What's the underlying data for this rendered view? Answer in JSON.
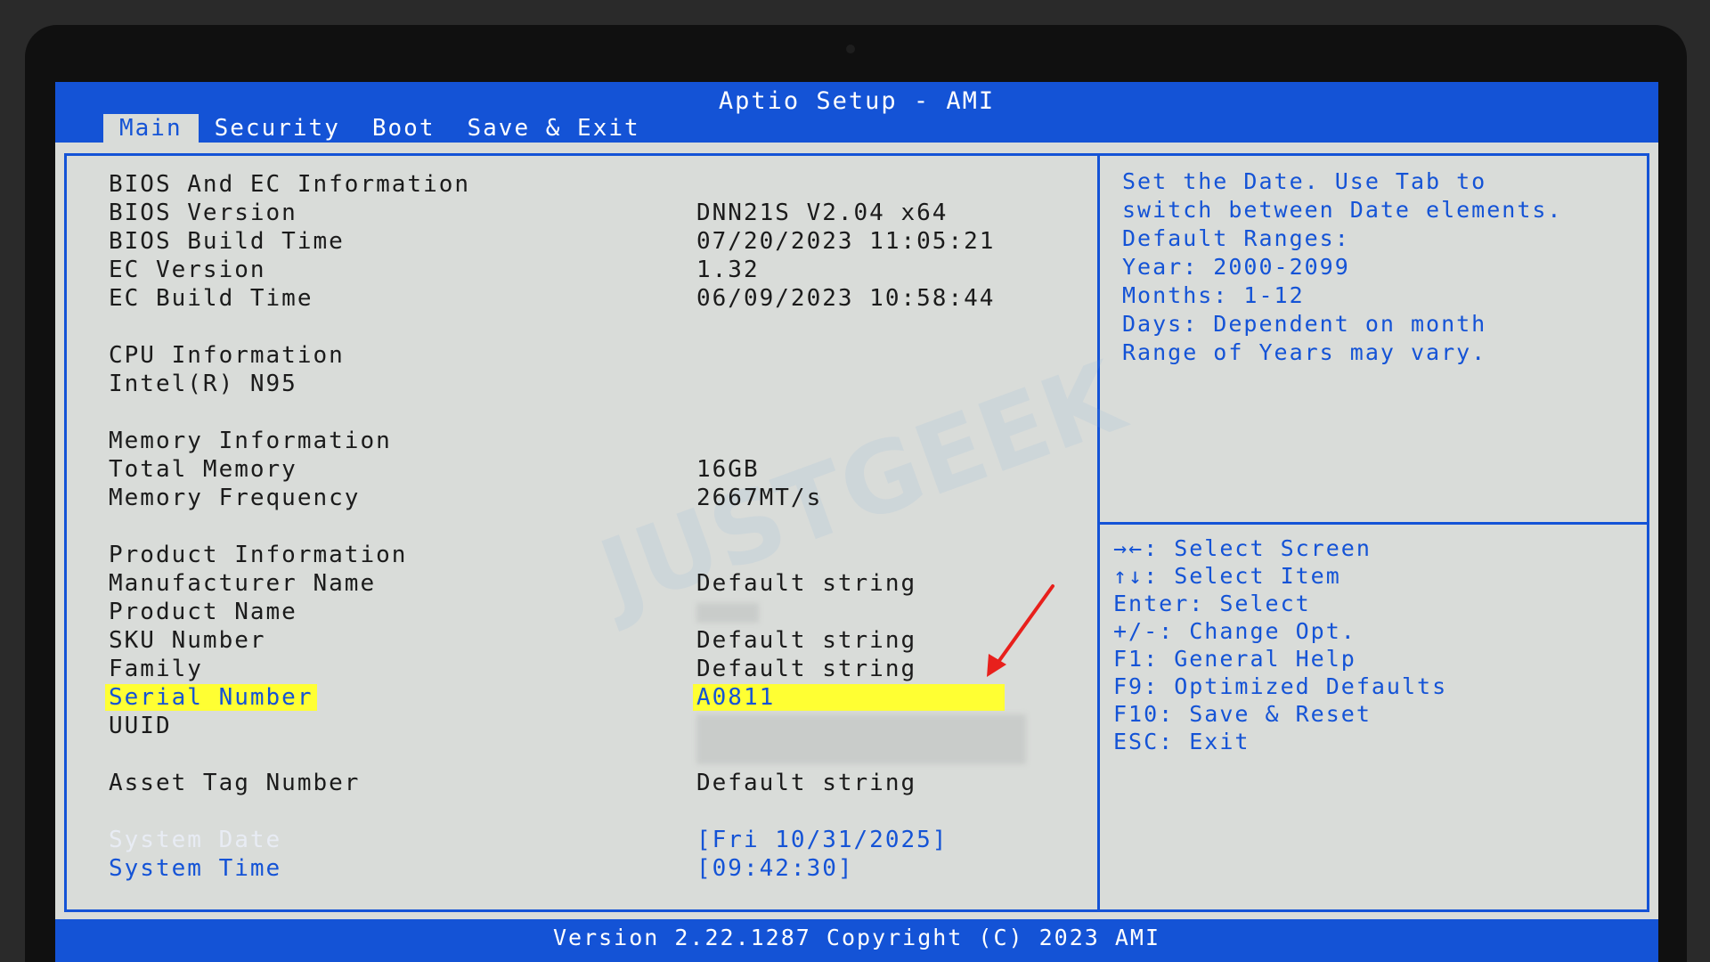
{
  "app": {
    "title": "Aptio Setup - AMI"
  },
  "tabs": [
    {
      "label": "Main",
      "active": true
    },
    {
      "label": "Security",
      "active": false
    },
    {
      "label": "Boot",
      "active": false
    },
    {
      "label": "Save & Exit",
      "active": false
    }
  ],
  "watermark": {
    "part1": "JUST",
    "part2": "GEEK"
  },
  "main": {
    "bios_ec_header": "BIOS And EC Information",
    "bios_version": {
      "label": "BIOS Version",
      "value": "DNN21S V2.04 x64"
    },
    "bios_build_time": {
      "label": "BIOS Build Time",
      "value": "07/20/2023 11:05:21"
    },
    "ec_version": {
      "label": "EC Version",
      "value": "1.32"
    },
    "ec_build_time": {
      "label": "EC Build Time",
      "value": "06/09/2023 10:58:44"
    },
    "cpu_header": "CPU Information",
    "cpu_name": "Intel(R) N95",
    "memory_header": "Memory Information",
    "total_memory": {
      "label": "Total Memory",
      "value": "16GB"
    },
    "memory_frequency": {
      "label": "Memory Frequency",
      "value": "2667MT/s"
    },
    "product_header": "Product Information",
    "manufacturer_name": {
      "label": "Manufacturer Name",
      "value": "Default string"
    },
    "product_name": {
      "label": "Product Name",
      "value": ""
    },
    "sku_number": {
      "label": "SKU Number",
      "value": "Default string"
    },
    "family": {
      "label": "Family",
      "value": "Default string"
    },
    "serial_number": {
      "label": "Serial Number",
      "value": "A0811"
    },
    "uuid": {
      "label": "UUID",
      "value": ""
    },
    "asset_tag": {
      "label": "Asset Tag Number",
      "value": "Default string"
    },
    "system_date": {
      "label": "System Date",
      "value": "[Fri 10/31/2025]"
    },
    "system_time": {
      "label": "System Time",
      "value": "[09:42:30]"
    }
  },
  "help": [
    "Set the Date. Use Tab to",
    "switch between Date elements.",
    "Default Ranges:",
    "Year: 2000-2099",
    "Months: 1-12",
    "Days: Dependent on month",
    "Range of Years may vary."
  ],
  "keys": [
    "→←: Select Screen",
    "↑↓: Select Item",
    "Enter: Select",
    "+/-: Change Opt.",
    "F1: General Help",
    "F9: Optimized Defaults",
    "F10: Save & Reset",
    "ESC: Exit"
  ],
  "footer": "Version 2.22.1287 Copyright (C) 2023 AMI",
  "colors": {
    "accent": "#1453d6",
    "background": "#d9dcd9",
    "highlight": "#ffff33",
    "annotation": "#e8201c"
  }
}
